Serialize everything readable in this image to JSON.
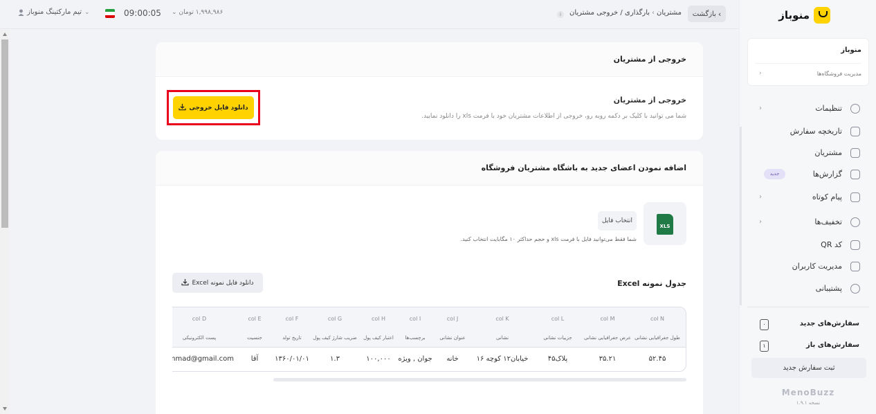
{
  "topbar": {
    "user_label": "تیم مارکتینگ منوباز",
    "clock": "09:00:05",
    "wallet": "۱,۹۹۸,۹۸۶ تومان",
    "info": "i",
    "breadcrumb_root": "مشتریان",
    "breadcrumb_current": "بارگذاری / خروجی مشتریان",
    "back_label": "بازگشت",
    "flag_colors": [
      "#239f40",
      "#ffffff",
      "#da0000"
    ]
  },
  "export_card": {
    "header_title": "خروجی از مشتریان",
    "section_title": "خروجی از مشتریان",
    "description": "شما می توانید با کلیک بر دکمه روبه رو، خروجی از اطلاعات مشتریان خود با فرمت xls را دانلود نمایید.",
    "download_label": "دانلود فایل خروجی"
  },
  "import_card": {
    "header_title": "اضافه نمودن اعضای جدید به باشگاه مشتریان فروشگاه",
    "xls_label": "XLS",
    "pick_file_label": "انتخاب فایل",
    "pick_note": "شما فقط می‌توانید فایل با فرمت xls و حجم حداکثر ۱۰ مگابایت انتخاب کنید.",
    "sample_title": "جدول نمونه Excel",
    "sample_download_label": "دانلود فایل نمونه Excel"
  },
  "sample_table": {
    "columns": [
      {
        "col": "col N",
        "label": "طول جغرافیایی نشانی",
        "value": "۵۲.۴۵"
      },
      {
        "col": "col M",
        "label": "عرض جغرافیایی نشانی",
        "value": "۳۵.۲۱"
      },
      {
        "col": "col L",
        "label": "جزییات نشانی",
        "value": "پلاک۴۵"
      },
      {
        "col": "col K",
        "label": "نشانی",
        "value": "خیابان۱۲ کوچه ۱۶"
      },
      {
        "col": "col J",
        "label": "عنوان نشانی",
        "value": "خانه"
      },
      {
        "col": "col I",
        "label": "برچسب‌ها",
        "value": "جوان , ویژه"
      },
      {
        "col": "col H",
        "label": "اعتبار کیف پول",
        "value": "۱۰۰,۰۰۰"
      },
      {
        "col": "col G",
        "label": "ضریب شارژ کیف پول",
        "value": "۱.۳"
      },
      {
        "col": "col F",
        "label": "تاریخ تولد",
        "value": "۱۳۶۰/۰۱/۰۱"
      },
      {
        "col": "col E",
        "label": "جنسیت",
        "value": "آقا"
      },
      {
        "col": "col D",
        "label": "پست الکترونیکی",
        "value": "hammad@gmail.com"
      }
    ]
  },
  "sidebar": {
    "brand": "منوباز",
    "store_name": "منوباز",
    "store_manage": "مدیریت فروشگاه‌ها",
    "items": [
      {
        "label": "تنظیمات",
        "icon": "gear-icon",
        "chevron": "‹"
      },
      {
        "label": "تاریخچه سفارش",
        "icon": "document-icon"
      },
      {
        "label": "مشتریان",
        "icon": "users-icon"
      },
      {
        "label": "گزارش‌ها",
        "icon": "chart-icon",
        "badge": "جدید"
      },
      {
        "label": "پیام کوتاه",
        "icon": "message-icon",
        "chevron": "‹"
      },
      {
        "label": "تخفیف‌ها",
        "icon": "discount-icon",
        "chevron": "‹"
      },
      {
        "label": "کد QR",
        "icon": "qr-icon"
      },
      {
        "label": "مدیریت کاربران",
        "icon": "user-manage-icon"
      },
      {
        "label": "پشتیبانی",
        "icon": "headset-icon"
      }
    ],
    "new_orders_label": "سفارش‌های جدید",
    "new_orders_count": "۰",
    "open_orders_label": "سفارش‌های باز",
    "open_orders_count": "۱",
    "new_order_button": "ثبت سفارش جدید",
    "footer_brand": "MenoBuzz",
    "version": "نسخه ۱.۹.۱"
  }
}
